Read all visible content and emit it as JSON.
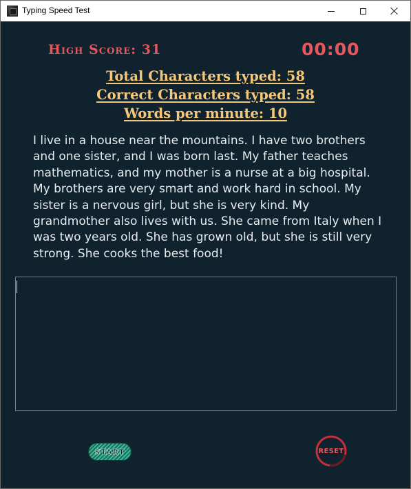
{
  "window": {
    "title": "Typing Speed Test"
  },
  "header": {
    "high_score": "High Score: 31",
    "timer": "00:00"
  },
  "stats": {
    "total_characters": "Total Characters typed: 58",
    "correct_characters": "Correct Characters typed: 58",
    "words_per_minute": "Words per minute: 10"
  },
  "passage": {
    "text": "I live in a house near the mountains. I have two brothers and one sister, and I was born last. My father teaches mathematics, and my mother is a nurse at a big hospital. My brothers are very smart and work hard in school. My sister is a nervous girl, but she is very kind. My grandmother also lives with us. She came from Italy when I was two years old. She has grown old, but she is still very strong. She cooks the best food!"
  },
  "typing_area": {
    "value": ""
  },
  "controls": {
    "start_label": "START",
    "reset_label": "RESET"
  },
  "colors": {
    "background": "#0f222d",
    "accent_red": "#e8555c",
    "stats_gold": "#f4c77a",
    "passage_text": "#e6ecf0",
    "start_green": "#39b99a"
  }
}
